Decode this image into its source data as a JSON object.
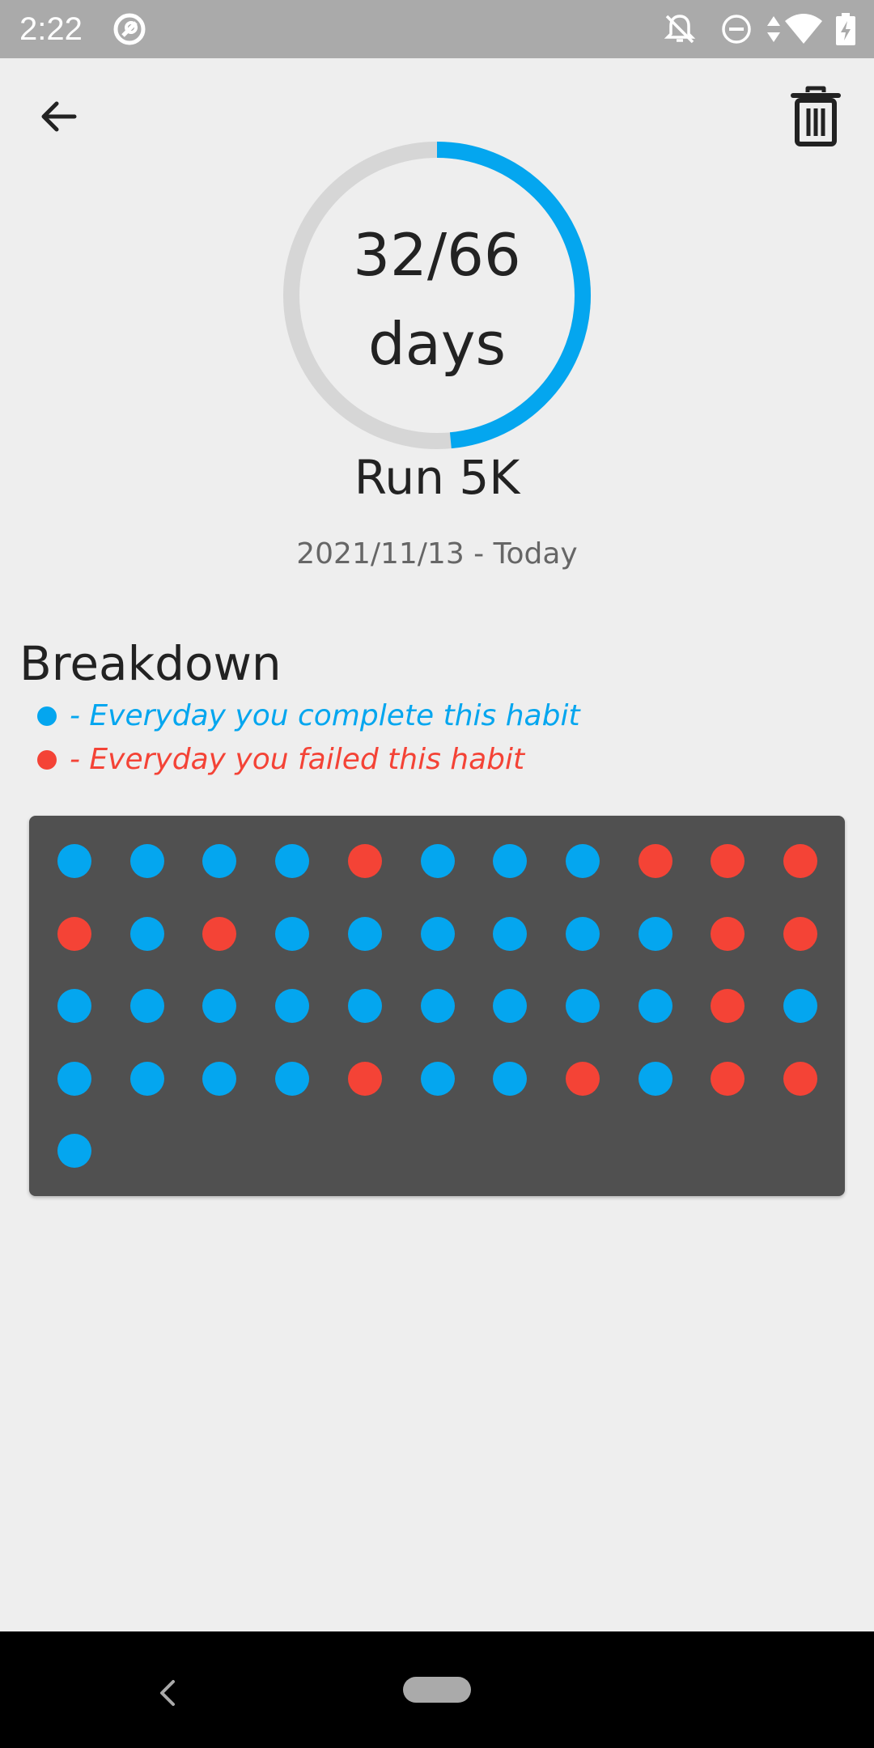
{
  "status_bar": {
    "time": "2:22"
  },
  "habit": {
    "progress_text": "32/66",
    "progress_unit": "days",
    "completed_days": 32,
    "target_days": 66,
    "title": "Run 5K",
    "date_range": "2021/11/13 - Today"
  },
  "breakdown": {
    "heading": "Breakdown",
    "legend": {
      "complete": "- Everyday you complete this habit",
      "failed": "- Everyday you failed this habit"
    },
    "days": [
      "complete",
      "complete",
      "complete",
      "complete",
      "failed",
      "complete",
      "complete",
      "complete",
      "failed",
      "failed",
      "failed",
      "failed",
      "complete",
      "failed",
      "complete",
      "complete",
      "complete",
      "complete",
      "complete",
      "complete",
      "failed",
      "failed",
      "complete",
      "complete",
      "complete",
      "complete",
      "complete",
      "complete",
      "complete",
      "complete",
      "complete",
      "failed",
      "complete",
      "complete",
      "complete",
      "complete",
      "complete",
      "failed",
      "complete",
      "complete",
      "failed",
      "complete",
      "failed",
      "failed",
      "complete"
    ]
  },
  "colors": {
    "complete": "#04a6ef",
    "failed": "#f44336",
    "ring_track": "#d6d6d6",
    "card_background": "#505050"
  }
}
